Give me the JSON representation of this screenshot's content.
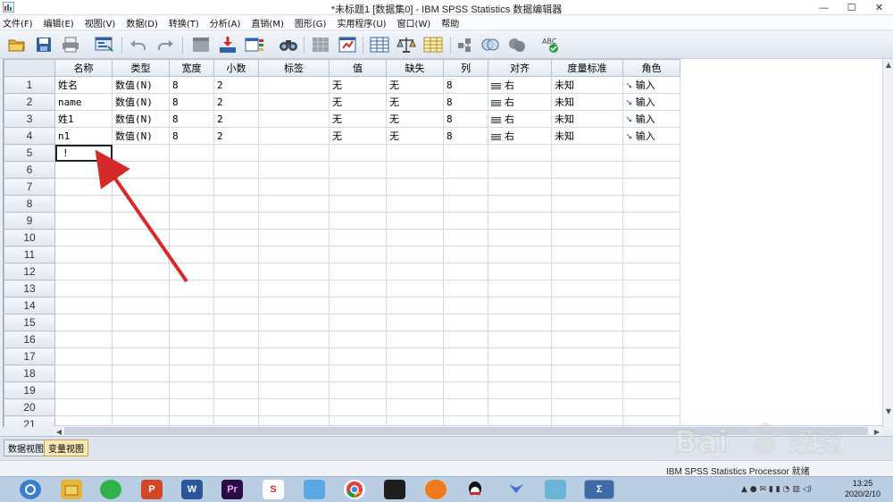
{
  "window": {
    "title": "*未标题1 [数据集0] - IBM SPSS Statistics 数据编辑器",
    "minimize": "—",
    "maximize": "☐",
    "close": "✕"
  },
  "menu": [
    "文件(F)",
    "编辑(E)",
    "视图(V)",
    "数据(D)",
    "转换(T)",
    "分析(A)",
    "直销(M)",
    "图形(G)",
    "实用程序(U)",
    "窗口(W)",
    "帮助"
  ],
  "toolbar": [
    "open-folder-icon",
    "save-icon",
    "print-icon",
    "dialog-recall-icon",
    "undo-icon",
    "redo-icon",
    "goto-case-icon",
    "goto-variable-icon",
    "variables-icon",
    "find-icon",
    "insert-cases-icon",
    "insert-variable-icon",
    "split-file-icon",
    "weight-cases-icon",
    "select-cases-icon",
    "value-labels-icon",
    "use-sets-icon",
    "show-all-variables-icon",
    "spell-check-icon"
  ],
  "grid": {
    "columns": [
      "名称",
      "类型",
      "宽度",
      "小数",
      "标签",
      "值",
      "缺失",
      "列",
      "对齐",
      "度量标准",
      "角色"
    ],
    "rows": [
      {
        "num": "1",
        "name": "姓名",
        "type": "数值(N)",
        "width": "8",
        "decimals": "2",
        "label": "",
        "values": "无",
        "missing": "无",
        "columns": "8",
        "align": "右",
        "measure": "未知",
        "role": "输入"
      },
      {
        "num": "2",
        "name": "name",
        "type": "数值(N)",
        "width": "8",
        "decimals": "2",
        "label": "",
        "values": "无",
        "missing": "无",
        "columns": "8",
        "align": "右",
        "measure": "未知",
        "role": "输入"
      },
      {
        "num": "3",
        "name": "姓1",
        "type": "数值(N)",
        "width": "8",
        "decimals": "2",
        "label": "",
        "values": "无",
        "missing": "无",
        "columns": "8",
        "align": "右",
        "measure": "未知",
        "role": "输入"
      },
      {
        "num": "4",
        "name": "n1",
        "type": "数值(N)",
        "width": "8",
        "decimals": "2",
        "label": "",
        "values": "无",
        "missing": "无",
        "columns": "8",
        "align": "右",
        "measure": "未知",
        "role": "输入"
      }
    ],
    "active_cell_value": "!",
    "empty_row_numbers": [
      "5",
      "6",
      "7",
      "8",
      "9",
      "10",
      "11",
      "12",
      "13",
      "14",
      "15",
      "16",
      "17",
      "18",
      "19",
      "20",
      "21"
    ]
  },
  "tabs": {
    "data_view": "数据视图",
    "variable_view": "变量视图",
    "selected": "variable_view"
  },
  "status": {
    "processor": "IBM SPSS Statistics Processor 就绪"
  },
  "taskbar": {
    "apps": [
      "Windows",
      "文件资源管理器",
      "微信",
      "PowerPoint",
      "Word",
      "Premiere",
      "WPS",
      "应用",
      "Chrome",
      "视频",
      "播放器",
      "QQ",
      "飞书",
      "记事本",
      "SPSS"
    ],
    "time": "13:25",
    "date": "2020/2/10"
  },
  "colors": {
    "accent": "#1a5fb4",
    "annotation_arrow": "#d42a2a",
    "selected_tab": "#fbe9b6"
  },
  "watermark": "Baidu经验"
}
